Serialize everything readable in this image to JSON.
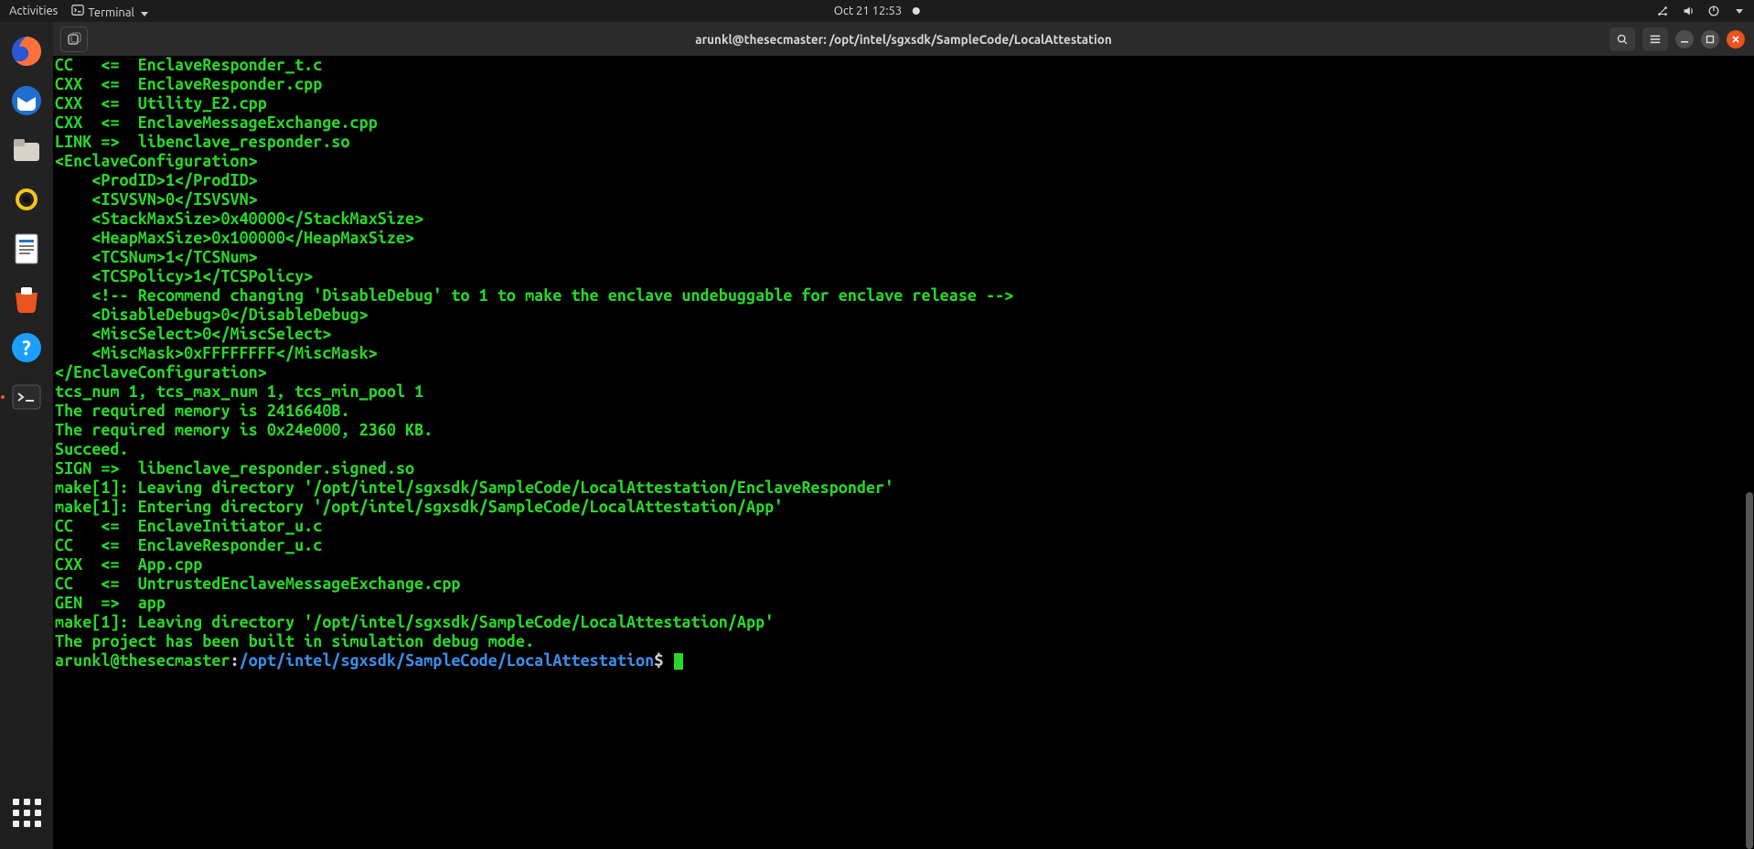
{
  "topbar": {
    "activities": "Activities",
    "app_label": "Terminal",
    "clock": "Oct 21  12:53"
  },
  "dock": {
    "items": [
      {
        "name": "firefox",
        "color1": "#ff7139",
        "color2": "#9059ff"
      },
      {
        "name": "thunderbird",
        "color1": "#1f6fd0",
        "color2": "#0a3d75"
      },
      {
        "name": "files",
        "color1": "#d7d3cb",
        "color2": "#b7b2a8"
      },
      {
        "name": "rhythmbox",
        "color1": "#f5c518",
        "color2": "#111"
      },
      {
        "name": "libreoffice",
        "color1": "#ffffff",
        "color2": "#2a73c7"
      },
      {
        "name": "software",
        "color1": "#e95420",
        "color2": "#ffffff"
      },
      {
        "name": "help",
        "color1": "#1a9fff",
        "color2": "#ffffff"
      },
      {
        "name": "terminal",
        "color1": "#2b2b2b",
        "color2": "#e0e0e0",
        "active": true
      }
    ]
  },
  "terminal": {
    "title": "arunkl@thesecmaster: /opt/intel/sgxsdk/SampleCode/LocalAttestation",
    "prompt": {
      "userhost": "arunkl@thesecmaster",
      "cwd": "/opt/intel/sgxsdk/SampleCode/LocalAttestation",
      "sep": ":",
      "end": "$"
    },
    "lines": [
      "CC   <=  EnclaveResponder_t.c",
      "CXX  <=  EnclaveResponder.cpp",
      "CXX  <=  Utility_E2.cpp",
      "CXX  <=  EnclaveMessageExchange.cpp",
      "LINK =>  libenclave_responder.so",
      "<EnclaveConfiguration>",
      "    <ProdID>1</ProdID>",
      "    <ISVSVN>0</ISVSVN>",
      "    <StackMaxSize>0x40000</StackMaxSize>",
      "    <HeapMaxSize>0x100000</HeapMaxSize>",
      "    <TCSNum>1</TCSNum>",
      "    <TCSPolicy>1</TCSPolicy>",
      "    <!-- Recommend changing 'DisableDebug' to 1 to make the enclave undebuggable for enclave release -->",
      "    <DisableDebug>0</DisableDebug>",
      "    <MiscSelect>0</MiscSelect>",
      "    <MiscMask>0xFFFFFFFF</MiscMask>",
      "</EnclaveConfiguration>",
      "tcs_num 1, tcs_max_num 1, tcs_min_pool 1",
      "The required memory is 2416640B.",
      "The required memory is 0x24e000, 2360 KB.",
      "Succeed.",
      "SIGN =>  libenclave_responder.signed.so",
      "make[1]: Leaving directory '/opt/intel/sgxsdk/SampleCode/LocalAttestation/EnclaveResponder'",
      "make[1]: Entering directory '/opt/intel/sgxsdk/SampleCode/LocalAttestation/App'",
      "CC   <=  EnclaveInitiator_u.c",
      "CC   <=  EnclaveResponder_u.c",
      "CXX  <=  App.cpp",
      "CC   <=  UntrustedEnclaveMessageExchange.cpp",
      "GEN  =>  app",
      "make[1]: Leaving directory '/opt/intel/sgxsdk/SampleCode/LocalAttestation/App'",
      "The project has been built in simulation debug mode."
    ]
  },
  "scrollbar": {
    "top_pct": 55,
    "height_pct": 45
  }
}
